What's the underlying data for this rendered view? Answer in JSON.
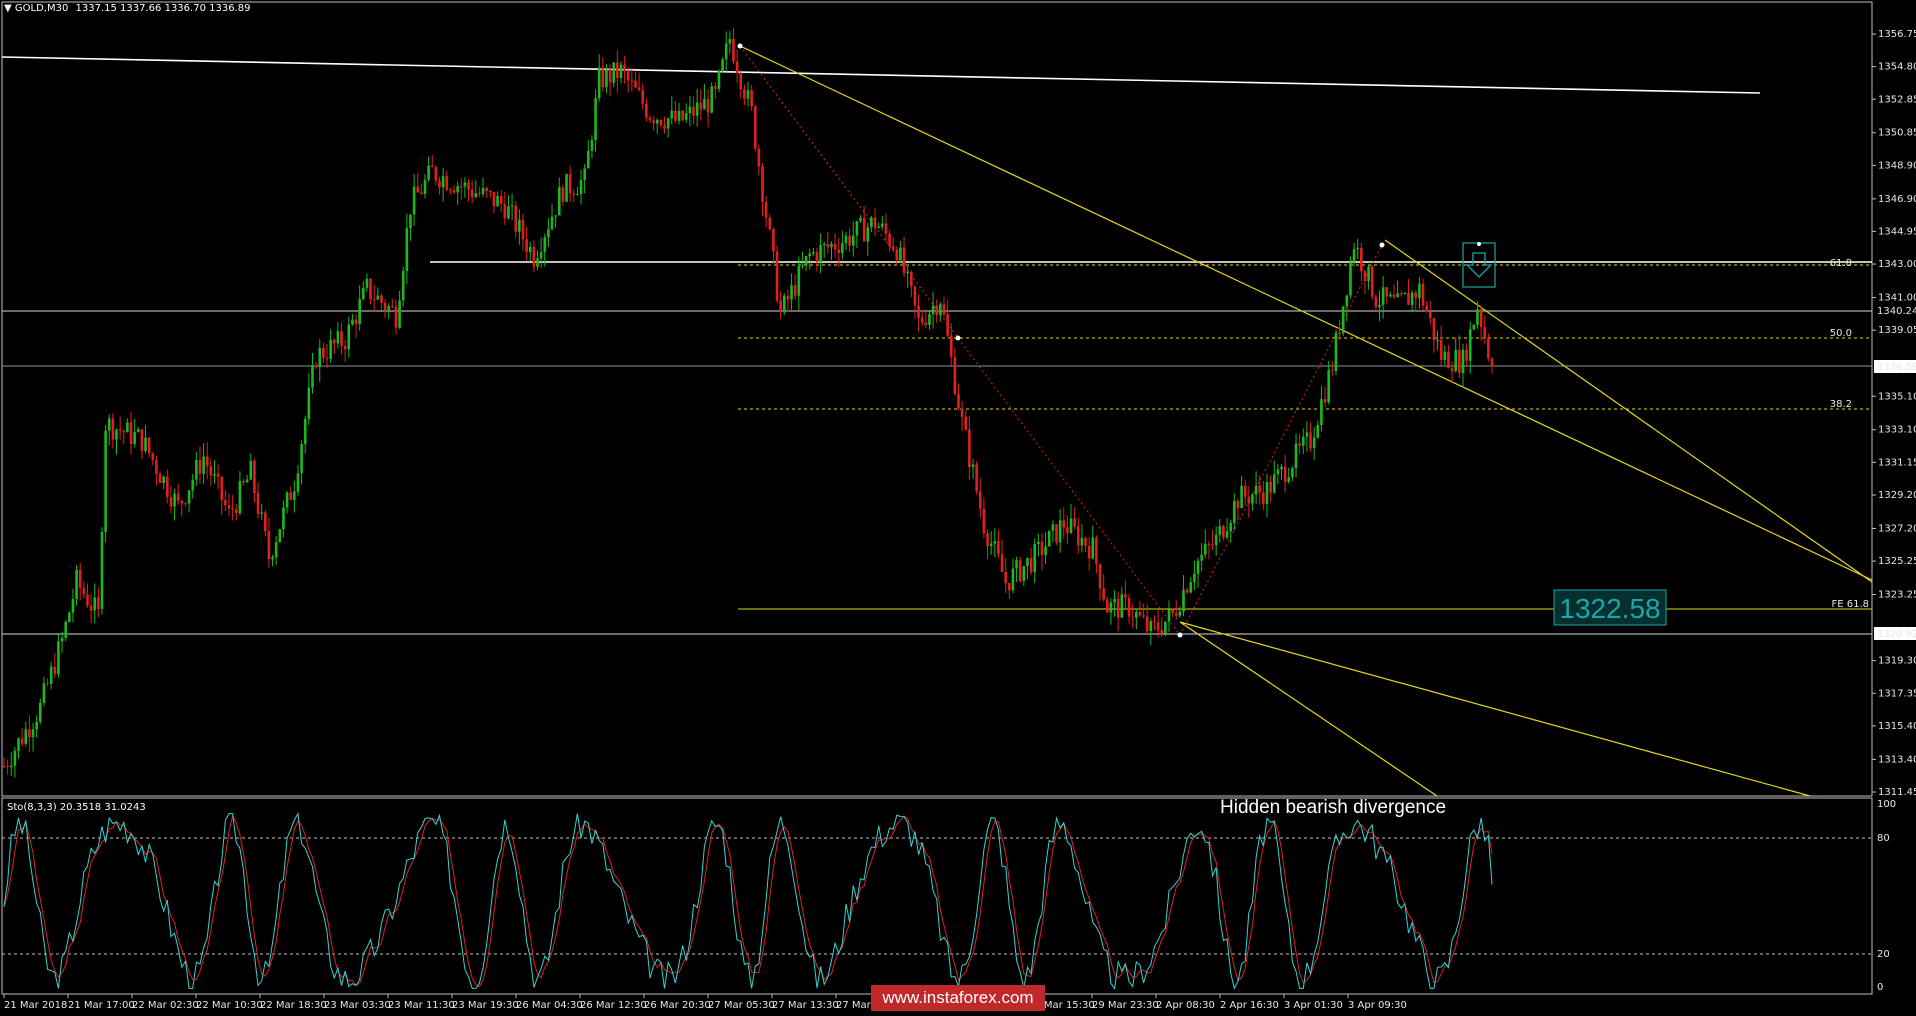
{
  "header": {
    "symbol": "GOLD,M30",
    "ohlc": "1337.15 1337.66 1336.70 1336.89"
  },
  "stochastic": {
    "title": "Sto(8,3,3) 20.3518 31.0243",
    "levels": [
      "100",
      "80",
      "20",
      "0"
    ]
  },
  "annotation": "Hidden bearish divergence",
  "watermark": "www.instaforex.com",
  "target_label": "1322.58",
  "colors": {
    "bull_candle": "#1db81d",
    "bear_candle": "#e02020",
    "channel": "#e6d81a",
    "fib": "#e6d81a",
    "stoch_main": "#2fd6d6",
    "stoch_signal": "#e02020",
    "accent": "#1aa7a7"
  },
  "chart_data": {
    "type": "candlestick",
    "price_axis_ticks": [
      "1356.75",
      "1354.80",
      "1352.85",
      "1350.85",
      "1348.90",
      "1346.90",
      "1344.95",
      "1343.00",
      "1341.00",
      "1339.05",
      "1335.10",
      "1333.10",
      "1331.15",
      "1329.20",
      "1327.20",
      "1325.25",
      "1323.25",
      "1319.30",
      "1317.35",
      "1315.40",
      "1313.40",
      "1311.45"
    ],
    "price_labels": {
      "current": "1336.89",
      "line_1340": "1340.24",
      "line_1320": "1320.92"
    },
    "time_axis_ticks": [
      "21 Mar 2018",
      "21 Mar 17:00",
      "22 Mar 02:30",
      "22 Mar 10:30",
      "22 Mar 18:30",
      "23 Mar 03:30",
      "23 Mar 11:30",
      "23 Mar 19:30",
      "26 Mar 04:30",
      "26 Mar 12:30",
      "26 Mar 20:30",
      "27 Mar 05:30",
      "27 Mar 13:30",
      "27 Mar 2",
      "Mar 22:30",
      "29 Mar 07:30",
      "29 Mar 15:30",
      "29 Mar 23:30",
      "2 Apr 08:30",
      "2 Apr 16:30",
      "3 Apr 01:30",
      "3 Apr 09:30"
    ],
    "fib_levels": [
      {
        "label": "61.8",
        "price": 1343.0
      },
      {
        "label": "50.0",
        "price": 1338.6
      },
      {
        "label": "38.2",
        "price": 1334.4
      },
      {
        "label": "FE 61.8",
        "price": 1322.58
      }
    ],
    "price_anchors": [
      {
        "t": 0,
        "p": 1313.0
      },
      {
        "t": 10,
        "p": 1316.5
      },
      {
        "t": 16,
        "p": 1320.5
      },
      {
        "t": 20,
        "p": 1324.0
      },
      {
        "t": 26,
        "p": 1322.0
      },
      {
        "t": 28,
        "p": 1333.5
      },
      {
        "t": 38,
        "p": 1332.5
      },
      {
        "t": 48,
        "p": 1328.5
      },
      {
        "t": 55,
        "p": 1331.5
      },
      {
        "t": 62,
        "p": 1328.0
      },
      {
        "t": 68,
        "p": 1330.5
      },
      {
        "t": 73,
        "p": 1325.5
      },
      {
        "t": 80,
        "p": 1330.0
      },
      {
        "t": 86,
        "p": 1337.5
      },
      {
        "t": 94,
        "p": 1338.5
      },
      {
        "t": 100,
        "p": 1341.5
      },
      {
        "t": 108,
        "p": 1340.0
      },
      {
        "t": 112,
        "p": 1346.5
      },
      {
        "t": 118,
        "p": 1348.5
      },
      {
        "t": 128,
        "p": 1347.5
      },
      {
        "t": 138,
        "p": 1346.5
      },
      {
        "t": 146,
        "p": 1343.5
      },
      {
        "t": 154,
        "p": 1347.5
      },
      {
        "t": 160,
        "p": 1348.0
      },
      {
        "t": 164,
        "p": 1354.0
      },
      {
        "t": 170,
        "p": 1354.5
      },
      {
        "t": 178,
        "p": 1352.0
      },
      {
        "t": 186,
        "p": 1351.5
      },
      {
        "t": 196,
        "p": 1353.0
      },
      {
        "t": 200,
        "p": 1356.5
      },
      {
        "t": 206,
        "p": 1352.0
      },
      {
        "t": 210,
        "p": 1346.0
      },
      {
        "t": 214,
        "p": 1340.0
      },
      {
        "t": 222,
        "p": 1343.5
      },
      {
        "t": 232,
        "p": 1344.5
      },
      {
        "t": 240,
        "p": 1345.5
      },
      {
        "t": 246,
        "p": 1344.0
      },
      {
        "t": 252,
        "p": 1339.5
      },
      {
        "t": 258,
        "p": 1341.0
      },
      {
        "t": 264,
        "p": 1333.5
      },
      {
        "t": 270,
        "p": 1327.5
      },
      {
        "t": 276,
        "p": 1324.0
      },
      {
        "t": 284,
        "p": 1325.5
      },
      {
        "t": 292,
        "p": 1327.5
      },
      {
        "t": 300,
        "p": 1326.0
      },
      {
        "t": 304,
        "p": 1322.5
      },
      {
        "t": 310,
        "p": 1322.5
      },
      {
        "t": 316,
        "p": 1321.0
      },
      {
        "t": 322,
        "p": 1322.0
      },
      {
        "t": 328,
        "p": 1325.0
      },
      {
        "t": 334,
        "p": 1326.5
      },
      {
        "t": 340,
        "p": 1329.0
      },
      {
        "t": 348,
        "p": 1329.5
      },
      {
        "t": 354,
        "p": 1331.0
      },
      {
        "t": 360,
        "p": 1332.5
      },
      {
        "t": 366,
        "p": 1337.0
      },
      {
        "t": 372,
        "p": 1344.3
      },
      {
        "t": 378,
        "p": 1341.0
      },
      {
        "t": 384,
        "p": 1340.5
      },
      {
        "t": 390,
        "p": 1341.5
      },
      {
        "t": 396,
        "p": 1337.5
      },
      {
        "t": 402,
        "p": 1337.2
      },
      {
        "t": 406,
        "p": 1340.5
      },
      {
        "t": 410,
        "p": 1336.89
      }
    ],
    "stoch_levels": [
      80,
      20
    ],
    "title": "",
    "xlabel": "",
    "ylabel": ""
  }
}
